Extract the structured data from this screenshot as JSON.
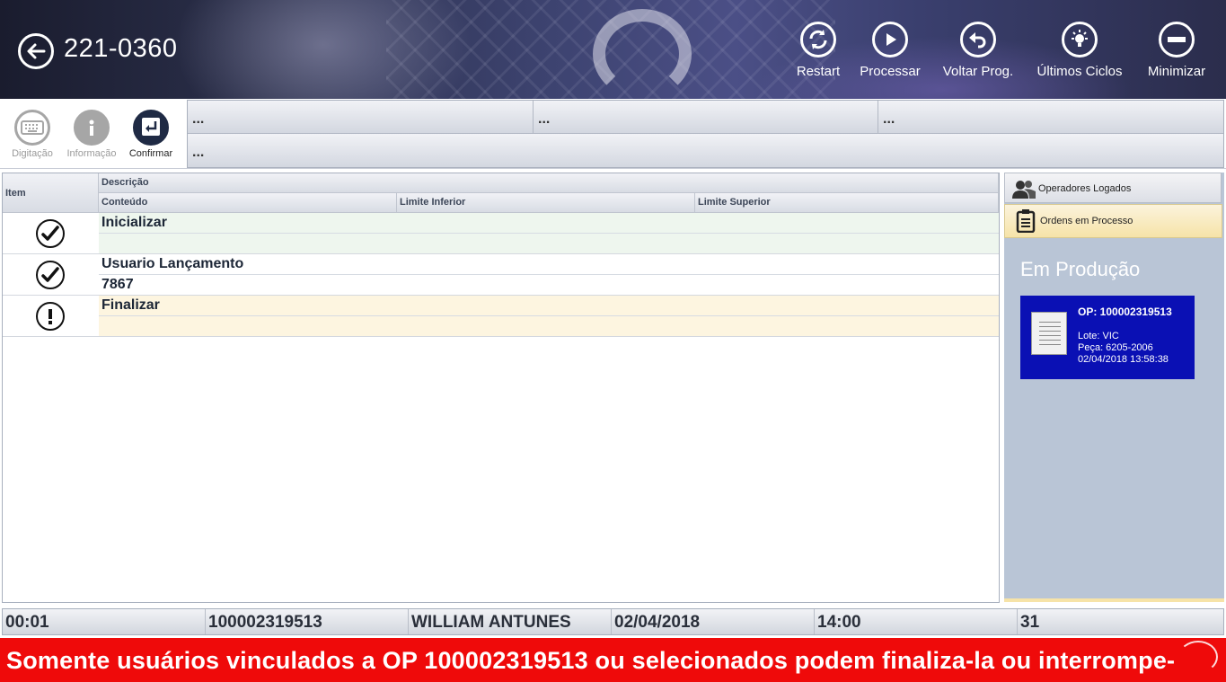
{
  "header": {
    "title": "221-0360",
    "buttons": [
      {
        "label": "Restart",
        "icon": "refresh-icon"
      },
      {
        "label": "Processar",
        "icon": "play-icon"
      },
      {
        "label": "Voltar Prog.",
        "icon": "undo-icon"
      },
      {
        "label": "Últimos Ciclos",
        "icon": "lightbulb-icon"
      },
      {
        "label": "Minimizar",
        "icon": "minus-icon"
      }
    ]
  },
  "toolbar": {
    "digitacao": "Digitação",
    "informacao": "Informação",
    "confirmar": "Confirmar"
  },
  "info_cells": [
    "...",
    "...",
    "...",
    "..."
  ],
  "table": {
    "headers": {
      "item": "Item",
      "descricao": "Descrição",
      "conteudo": "Conteúdo",
      "limite_inferior": "Limite Inferior",
      "limite_superior": "Limite Superior"
    },
    "rows": [
      {
        "descricao": "Inicializar",
        "conteudo": "",
        "status": "ok"
      },
      {
        "descricao": "Usuario Lançamento",
        "conteudo": "7867",
        "status": "ok"
      },
      {
        "descricao": "Finalizar",
        "conteudo": "",
        "status": "pending"
      }
    ]
  },
  "right_panel": {
    "tab_operadores": "Operadores Logados",
    "tab_ordens": "Ordens em Processo",
    "section_title": "Em Produção",
    "op_card": {
      "op": "OP: 100002319513",
      "lote": "Lote: VIC",
      "peca": "Peça: 6205-2006",
      "datetime": "02/04/2018 13:58:38"
    }
  },
  "status_bar": [
    "00:01",
    "100002319513",
    "WILLIAM ANTUNES",
    "02/04/2018",
    "14:00",
    "31"
  ],
  "message": "Somente usuários vinculados a OP 100002319513 ou selecionados podem finaliza-la ou interrompe-",
  "colors": {
    "message_bg": "#ef0a0a",
    "op_card_bg": "#0a10b4",
    "right_panel_bg": "#b9c5d6",
    "row_ok_bg": "#eef6ee",
    "row_pending_bg": "#fdf5e0"
  }
}
